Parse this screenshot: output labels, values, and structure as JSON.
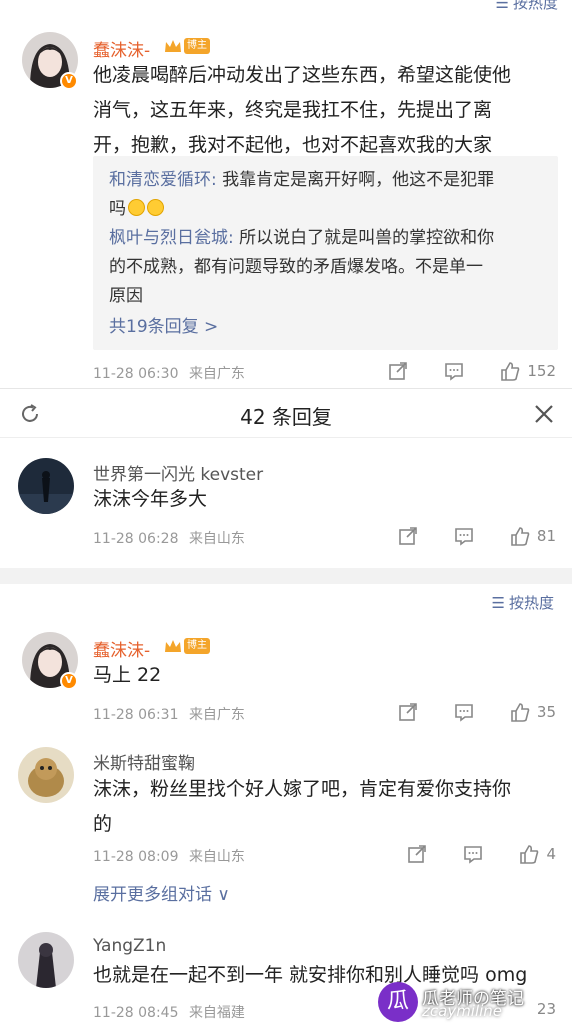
{
  "top_sort": {
    "label": "按热度"
  },
  "main_comment": {
    "username": "蠢沫沫-",
    "badge": "博主",
    "verified": "V",
    "lines": [
      "他凌晨喝醉后冲动发出了这些东西，希望这能使他",
      "消气，这五年来，终究是我扛不住，先提出了离",
      "开，抱歉，我对不起他，也对不起喜欢我的大家"
    ],
    "replies": [
      {
        "name": "和清恋爱循环:",
        "text": " 我靠肯定是离开好啊，他这不是犯罪",
        "cont": "吗"
      },
      {
        "name": "枫叶与烈日瓮城:",
        "text": " 所以说白了就是叫兽的掌控欲和你",
        "cont": "的不成熟，都有问题导致的矛盾爆发咯。不是单一",
        "cont2": "原因"
      }
    ],
    "more_replies": "共19条回复 >",
    "time": "11-28 06:30",
    "location": "来自广东",
    "likes": "152"
  },
  "panel": {
    "title": "42 条回复"
  },
  "comments": [
    {
      "username": "世界第一闪光 kevster",
      "text": "沫沫今年多大",
      "time": "11-28 06:28",
      "location": "来自山东",
      "likes": "81"
    },
    {
      "username": "蠢沫沫-",
      "badge": "博主",
      "verified": "V",
      "text": "马上 22",
      "time": "11-28 06:31",
      "location": "来自广东",
      "likes": "35"
    },
    {
      "username": "米斯特甜蜜鞠",
      "text": "沫沫，粉丝里找个好人嫁了吧，肯定有爱你支持你",
      "text2": "的",
      "time": "11-28 08:09",
      "location": "来自山东",
      "likes": "4"
    },
    {
      "username": "YangZ1n",
      "text": "也就是在一起不到一年 就安排你和别人睡觉吗 omg",
      "time": "11-28 08:45",
      "location": "来自福建",
      "likes": "23"
    }
  ],
  "sort_bar": {
    "label": "按热度"
  },
  "expand_link": "展开更多组对话 ∨",
  "watermark": {
    "logo": "瓜",
    "text": "瓜老师の笔记",
    "sub": "zcaymiline"
  },
  "colors": {
    "link": "#5a6fa0",
    "username_orange": "#e6622e",
    "badge": "#f4a52a",
    "watermark": "#7a2fc8"
  }
}
